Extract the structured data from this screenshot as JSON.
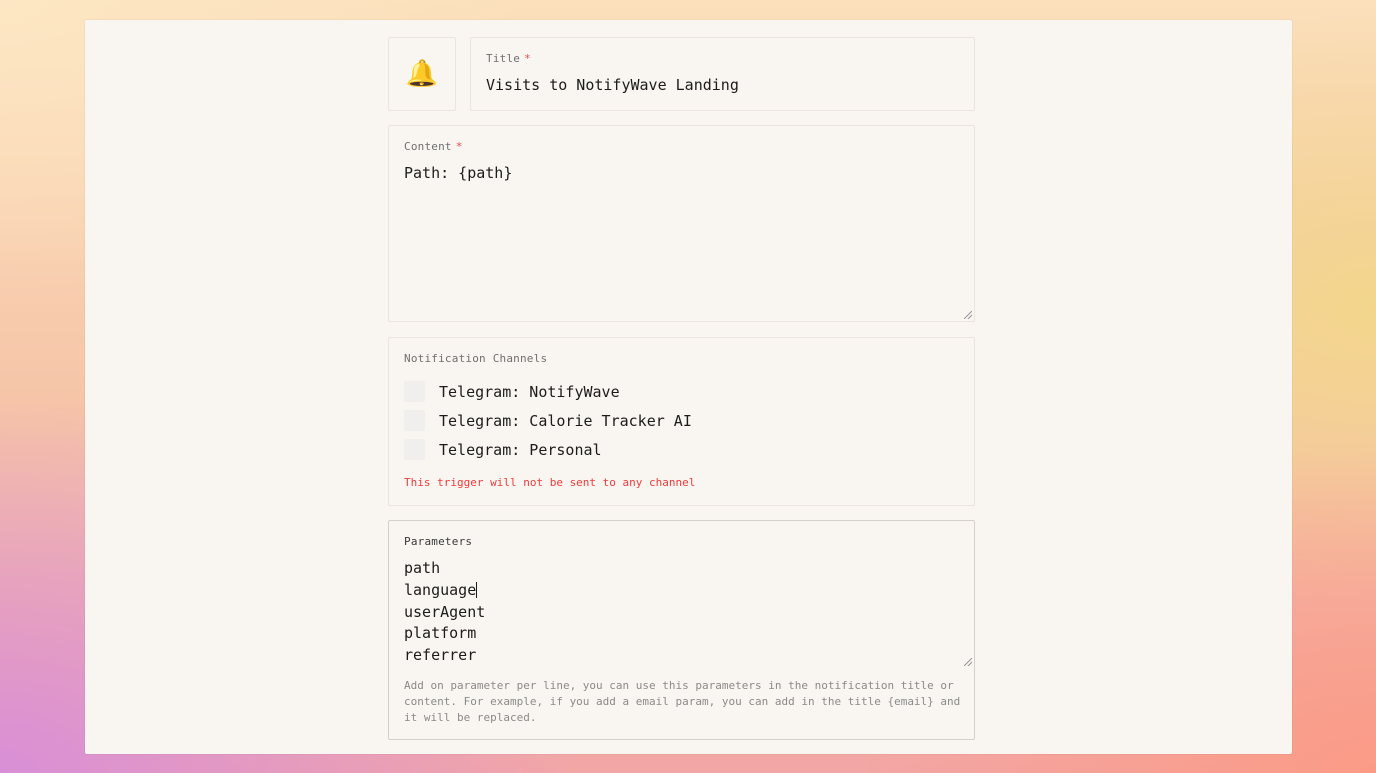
{
  "icon": {
    "emoji": "🔔",
    "name": "bell-icon"
  },
  "title_field": {
    "label": "Title",
    "required_mark": "*",
    "value": "Visits to NotifyWave Landing"
  },
  "content_field": {
    "label": "Content",
    "required_mark": "*",
    "value": "Path: {path}"
  },
  "channels": {
    "label": "Notification Channels",
    "items": [
      {
        "label": "Telegram: NotifyWave",
        "checked": false
      },
      {
        "label": "Telegram: Calorie Tracker AI",
        "checked": false
      },
      {
        "label": "Telegram: Personal",
        "checked": false
      }
    ],
    "warning": "This trigger will not be sent to any channel"
  },
  "parameters": {
    "label": "Parameters",
    "lines": [
      "path",
      "language",
      "userAgent",
      "platform",
      "referrer"
    ],
    "help": "Add on parameter per line, you can use this parameters in the notification title or content. For example, if you add a email param, you can add in the title {email} and it will be replaced."
  },
  "colors": {
    "error": "#ef3b3b",
    "panel": "#f9f5f1"
  }
}
